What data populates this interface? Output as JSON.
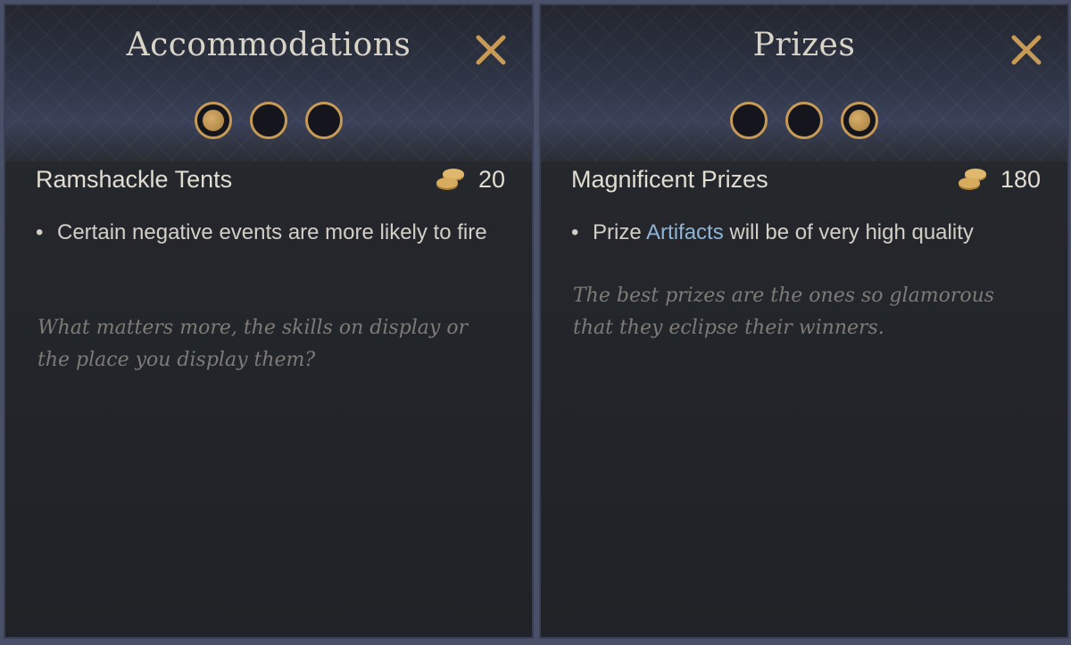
{
  "panels": [
    {
      "title": "Accommodations",
      "close_icon": "close-icon",
      "selected_tier": 1,
      "tiers": 3,
      "option": {
        "name": "Ramshackle Tents",
        "cost": "20",
        "cost_icon": "gold-coins-icon"
      },
      "effects": [
        {
          "text": "Certain negative events are more likely to fire"
        }
      ],
      "flavor": "What matters more, the skills on display or the place you display them?"
    },
    {
      "title": "Prizes",
      "close_icon": "close-icon",
      "selected_tier": 3,
      "tiers": 3,
      "option": {
        "name": "Magnificent Prizes",
        "cost": "180",
        "cost_icon": "gold-coins-icon"
      },
      "effects": [
        {
          "prefix": "Prize ",
          "link": "Artifacts",
          "suffix": " will be of very high quality"
        }
      ],
      "flavor": "The best prizes are the ones so glamorous that they eclipse their winners."
    }
  ],
  "colors": {
    "accent_gold": "#c79a55",
    "link_blue": "#8fb4d6",
    "flavor_gray": "#7e7b76"
  }
}
